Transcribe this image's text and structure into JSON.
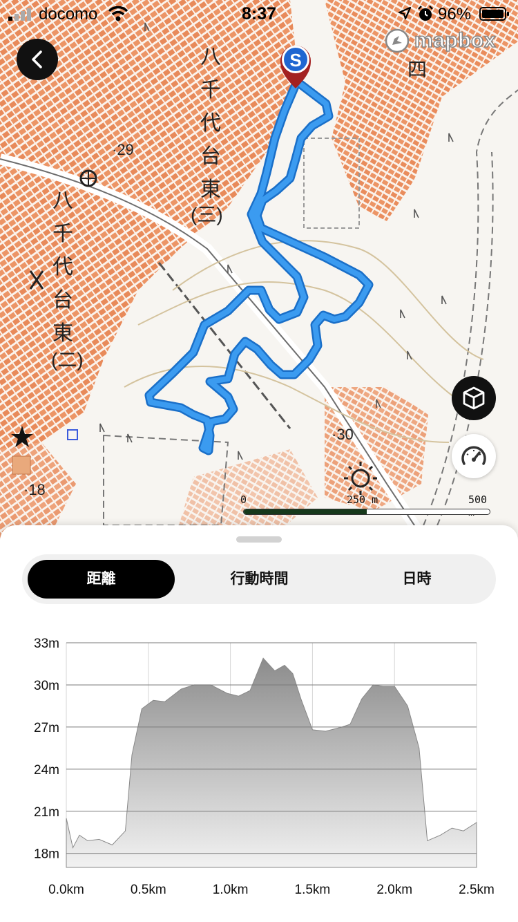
{
  "status_bar": {
    "carrier": "docomo",
    "time": "8:37",
    "battery_percent": "96%"
  },
  "map": {
    "attribution_logo": "mapbox",
    "labels": {
      "area_1_name": "八千代台東",
      "area_1_block": "(三)",
      "area_2_name": "八千代台東",
      "area_2_block": "(二)",
      "block_four": "四",
      "elevation_29": "29",
      "elevation_30": "30",
      "elevation_18": "18"
    },
    "start_marker_letter": "S",
    "scale_bar": {
      "label_0": "0",
      "label_250": "250 m",
      "label_500": "500 m"
    },
    "route_color": "#2f8fe0",
    "buttons": {
      "back_icon": "chevron-left-icon",
      "view_3d_icon": "cube-icon",
      "speed_icon": "speedometer-icon"
    }
  },
  "tabs": [
    {
      "label": "距離",
      "active": true
    },
    {
      "label": "行動時間",
      "active": false
    },
    {
      "label": "日時",
      "active": false
    }
  ],
  "chart_data": {
    "type": "area",
    "xlabel": "",
    "ylabel": "",
    "x_unit": "km",
    "y_unit": "m",
    "xlim": [
      0,
      2.5
    ],
    "ylim": [
      17,
      33
    ],
    "y_ticks": [
      18,
      21,
      24,
      27,
      30,
      33
    ],
    "y_tick_labels": [
      "18m",
      "21m",
      "24m",
      "27m",
      "30m",
      "33m"
    ],
    "x_ticks": [
      0,
      0.5,
      1.0,
      1.5,
      2.0,
      2.5
    ],
    "x_tick_labels": [
      "0.0km",
      "0.5km",
      "1.0km",
      "1.5km",
      "2.0km",
      "2.5km"
    ],
    "grid": true,
    "fill_color": "#9a9a9a",
    "points": [
      [
        0.0,
        20.5
      ],
      [
        0.04,
        18.4
      ],
      [
        0.08,
        19.3
      ],
      [
        0.13,
        18.9
      ],
      [
        0.2,
        19.0
      ],
      [
        0.28,
        18.6
      ],
      [
        0.36,
        19.6
      ],
      [
        0.4,
        25.0
      ],
      [
        0.46,
        28.3
      ],
      [
        0.53,
        28.9
      ],
      [
        0.6,
        28.8
      ],
      [
        0.7,
        29.7
      ],
      [
        0.78,
        30.0
      ],
      [
        0.88,
        30.0
      ],
      [
        0.98,
        29.4
      ],
      [
        1.05,
        29.2
      ],
      [
        1.12,
        29.6
      ],
      [
        1.2,
        31.9
      ],
      [
        1.27,
        31.0
      ],
      [
        1.33,
        31.4
      ],
      [
        1.38,
        30.8
      ],
      [
        1.43,
        29.0
      ],
      [
        1.5,
        26.8
      ],
      [
        1.58,
        26.7
      ],
      [
        1.68,
        27.0
      ],
      [
        1.73,
        27.2
      ],
      [
        1.8,
        29.0
      ],
      [
        1.87,
        30.0
      ],
      [
        1.93,
        29.9
      ],
      [
        2.0,
        29.9
      ],
      [
        2.08,
        28.5
      ],
      [
        2.15,
        25.5
      ],
      [
        2.2,
        18.9
      ],
      [
        2.28,
        19.3
      ],
      [
        2.35,
        19.8
      ],
      [
        2.42,
        19.6
      ],
      [
        2.5,
        20.2
      ]
    ]
  }
}
